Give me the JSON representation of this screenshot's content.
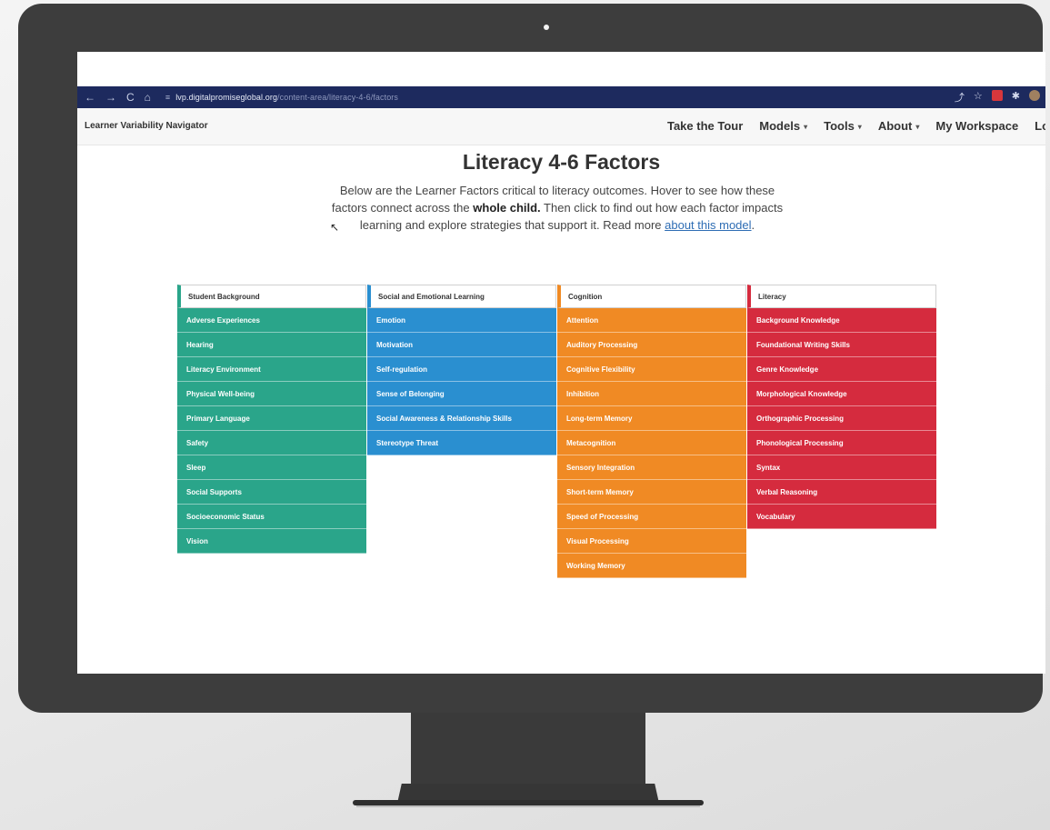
{
  "browser": {
    "nav_icons": [
      "←",
      "→",
      "C",
      "⌂"
    ],
    "url_host": "lvp.digitalpromiseglobal.org",
    "url_path": "/content-area/literacy-4-6/factors"
  },
  "site": {
    "brand": "Learner Variability Navigator",
    "menu": [
      {
        "label": "Take the Tour",
        "caret": false
      },
      {
        "label": "Models",
        "caret": true
      },
      {
        "label": "Tools",
        "caret": true
      },
      {
        "label": "About",
        "caret": true
      },
      {
        "label": "My Workspace",
        "caret": false
      },
      {
        "label": "Log",
        "caret": false
      }
    ]
  },
  "page": {
    "title": "Literacy 4-6 Factors",
    "intro_part1": "Below are the Learner Factors critical to literacy outcomes. Hover to see how these factors connect across the ",
    "intro_bold": "whole child.",
    "intro_part2": " Then click to find out how each factor impacts learning and explore strategies that support it. Read more ",
    "intro_link": "about this model",
    "intro_end": "."
  },
  "colors": {
    "student_background": "#2aa58a",
    "sel": "#2a8fd0",
    "cognition": "#f08a24",
    "literacy": "#d52b3e"
  },
  "columns": [
    {
      "title": "Student Background",
      "color_key": "student_background",
      "items": [
        "Adverse Experiences",
        "Hearing",
        "Literacy Environment",
        "Physical Well-being",
        "Primary Language",
        "Safety",
        "Sleep",
        "Social Supports",
        "Socioeconomic Status",
        "Vision"
      ]
    },
    {
      "title": "Social and Emotional Learning",
      "color_key": "sel",
      "items": [
        "Emotion",
        "Motivation",
        "Self-regulation",
        "Sense of Belonging",
        "Social Awareness & Relationship Skills",
        "Stereotype Threat"
      ]
    },
    {
      "title": "Cognition",
      "color_key": "cognition",
      "items": [
        "Attention",
        "Auditory Processing",
        "Cognitive Flexibility",
        "Inhibition",
        "Long-term Memory",
        "Metacognition",
        "Sensory Integration",
        "Short-term Memory",
        "Speed of Processing",
        "Visual Processing",
        "Working Memory"
      ]
    },
    {
      "title": "Literacy",
      "color_key": "literacy",
      "items": [
        "Background Knowledge",
        "Foundational Writing Skills",
        "Genre Knowledge",
        "Morphological Knowledge",
        "Orthographic Processing",
        "Phonological Processing",
        "Syntax",
        "Verbal Reasoning",
        "Vocabulary"
      ]
    }
  ]
}
